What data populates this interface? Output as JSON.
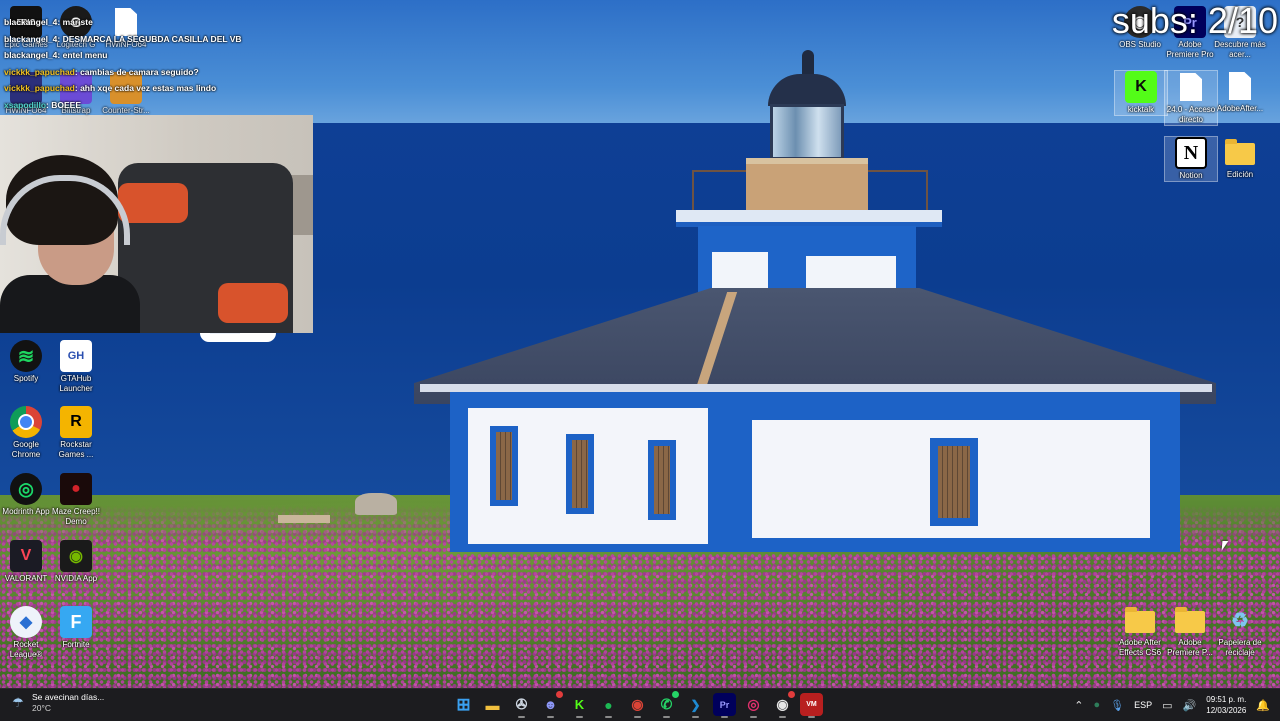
{
  "overlay": {
    "subs_label": "subs: 2/10",
    "chat": [
      {
        "user": "blackangel_4",
        "message": "mariste"
      },
      {
        "user": "blackangel_4",
        "message": "DESMARCA LA SEGUBDA CASILLA DEL VB"
      },
      {
        "user": "blackangel_4",
        "message": "entel menu"
      },
      {
        "user": "vickkk_papuchad",
        "message": "cambias de camara seguido?"
      },
      {
        "user": "vickkk_papuchad",
        "message": "ahh xqe cada vez estas mas lindo"
      },
      {
        "user": "xsapodillo",
        "message": "BOEEE"
      }
    ],
    "chat_separator": ": "
  },
  "desktop": {
    "top_left_icons": [
      {
        "label": "Epic Games",
        "icon": "epic-games-icon",
        "badge": "EPIC"
      },
      {
        "label": "Logitech G",
        "icon": "logitech-g-icon",
        "badge": "G"
      },
      {
        "label": "HWiNFO64",
        "icon": "hwinfo-icon",
        "badge": ""
      },
      {
        "label": "HWiNFO64",
        "icon": "hwinfo-icon",
        "badge": ""
      },
      {
        "label": "Blitstrap",
        "icon": "bloxstrap-icon",
        "badge": ""
      },
      {
        "label": "Counter-Str...",
        "icon": "counter-strike-icon",
        "badge": ""
      }
    ],
    "left_icons": [
      {
        "label": "Spotify",
        "icon": "spotify-icon",
        "color": "#1ed760"
      },
      {
        "label": "GTAHub Launcher",
        "icon": "gtahub-icon",
        "color": "#3f6fd1"
      },
      {
        "label": "Google Chrome",
        "icon": "chrome-icon",
        "color": "#e0433a"
      },
      {
        "label": "Rockstar Games ...",
        "icon": "rockstar-icon",
        "color": "#f4b400"
      },
      {
        "label": "Modrinth App",
        "icon": "modrinth-icon",
        "color": "#1bd96a"
      },
      {
        "label": "Maze Creep!! Demo",
        "icon": "maze-creep-icon",
        "color": "#b1121b"
      },
      {
        "label": "VALORANT",
        "icon": "valorant-icon",
        "color": "#fd4556"
      },
      {
        "label": "NVIDIA App",
        "icon": "nvidia-icon",
        "color": "#76b900"
      },
      {
        "label": "Rocket League®",
        "icon": "rocket-league-icon",
        "color": "#2a6fd3"
      },
      {
        "label": "Fortnite",
        "icon": "fortnite-icon",
        "color": "#36a8f2"
      }
    ],
    "right_icons": [
      {
        "label": "OBS Studio",
        "icon": "obs-icon"
      },
      {
        "label": "Adobe Premiere Pro",
        "icon": "premiere-pro-icon"
      },
      {
        "label": "Descubre más acer...",
        "icon": "discover-icon"
      },
      {
        "label": "kicktalk",
        "icon": "kicktalk-icon"
      },
      {
        "label": "24.0 - Acceso directo",
        "icon": "shortcut-file-icon"
      },
      {
        "label": "AdobeAfter...",
        "icon": "file-icon"
      },
      {
        "label": "Notion",
        "icon": "notion-icon"
      },
      {
        "label": "Edición",
        "icon": "folder-icon"
      },
      {
        "label": "Adobe After Effects CS6",
        "icon": "folder-icon"
      },
      {
        "label": "Adobe Premiere P...",
        "icon": "folder-icon"
      },
      {
        "label": "Papelera de reciclaje",
        "icon": "recycle-bin-icon"
      }
    ]
  },
  "taskbar": {
    "weather": {
      "text": "Se avecinan días...",
      "temp": "20°C"
    },
    "apps": [
      {
        "name": "windows-start",
        "glyph": "⊞",
        "color": "#2b8ae6"
      },
      {
        "name": "file-explorer",
        "glyph": "▬",
        "color": "#f1c03e"
      },
      {
        "name": "steam",
        "glyph": "S",
        "color": "#1b2838"
      },
      {
        "name": "discord",
        "glyph": "D",
        "color": "#5865f2"
      },
      {
        "name": "kicktalk",
        "glyph": "K",
        "color": "#53fc18"
      },
      {
        "name": "spotify",
        "glyph": "♫",
        "color": "#1db954"
      },
      {
        "name": "chrome",
        "glyph": "●",
        "color": "#db4437"
      },
      {
        "name": "whatsapp",
        "glyph": "✆",
        "color": "#25d366"
      },
      {
        "name": "vscode",
        "glyph": "❮❯",
        "color": "#1f8ad2"
      },
      {
        "name": "premiere",
        "glyph": "Pr",
        "color": "#2a1a55"
      },
      {
        "name": "instagram",
        "glyph": "◎",
        "color": "#d62976"
      },
      {
        "name": "obs",
        "glyph": "◉",
        "color": "#2b2b2b"
      },
      {
        "name": "voicemeeter",
        "glyph": "VM",
        "color": "#b81f1f"
      }
    ],
    "tray": {
      "language": "ESP",
      "time": "09:51 p. m.",
      "date": "12/03/2026"
    }
  }
}
